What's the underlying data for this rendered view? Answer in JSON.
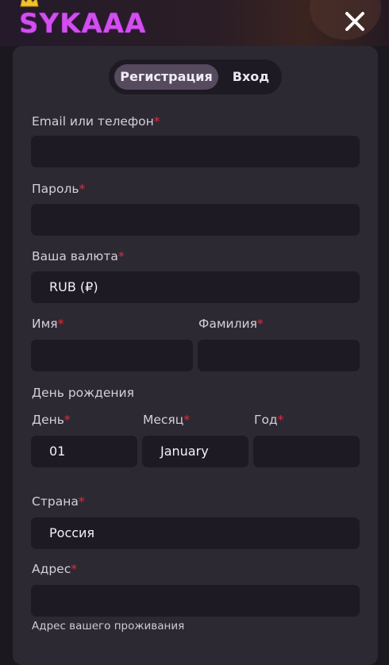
{
  "brand": {
    "logo_text": "SYKAAA"
  },
  "tabs": [
    {
      "label": "Регистрация",
      "active": true
    },
    {
      "label": "Вход",
      "active": false
    }
  ],
  "required_mark": "*",
  "form": {
    "email": {
      "label": "Email или телефон",
      "value": ""
    },
    "password": {
      "label": "Пароль",
      "value": ""
    },
    "currency": {
      "label": "Ваша валюта",
      "value": "RUB (₽)"
    },
    "first_name": {
      "label": "Имя",
      "value": ""
    },
    "last_name": {
      "label": "Фамилия",
      "value": ""
    },
    "birthday": {
      "section_label": "День рождения",
      "day": {
        "label": "День",
        "value": "01"
      },
      "month": {
        "label": "Месяц",
        "value": "January"
      },
      "year": {
        "label": "Год",
        "value": ""
      }
    },
    "country": {
      "label": "Страна",
      "value": "Россия"
    },
    "address": {
      "label": "Адрес",
      "value": "",
      "hint": "Адрес вашего проживания"
    }
  },
  "colors": {
    "background": "#1b1820",
    "card": "#2d2933",
    "input": "#1e1a23",
    "active_tab": "#564a5e",
    "logo": "#d24ef0",
    "required": "#e22b3c"
  },
  "icons": {
    "close": "close-icon",
    "crown": "crown-icon"
  }
}
